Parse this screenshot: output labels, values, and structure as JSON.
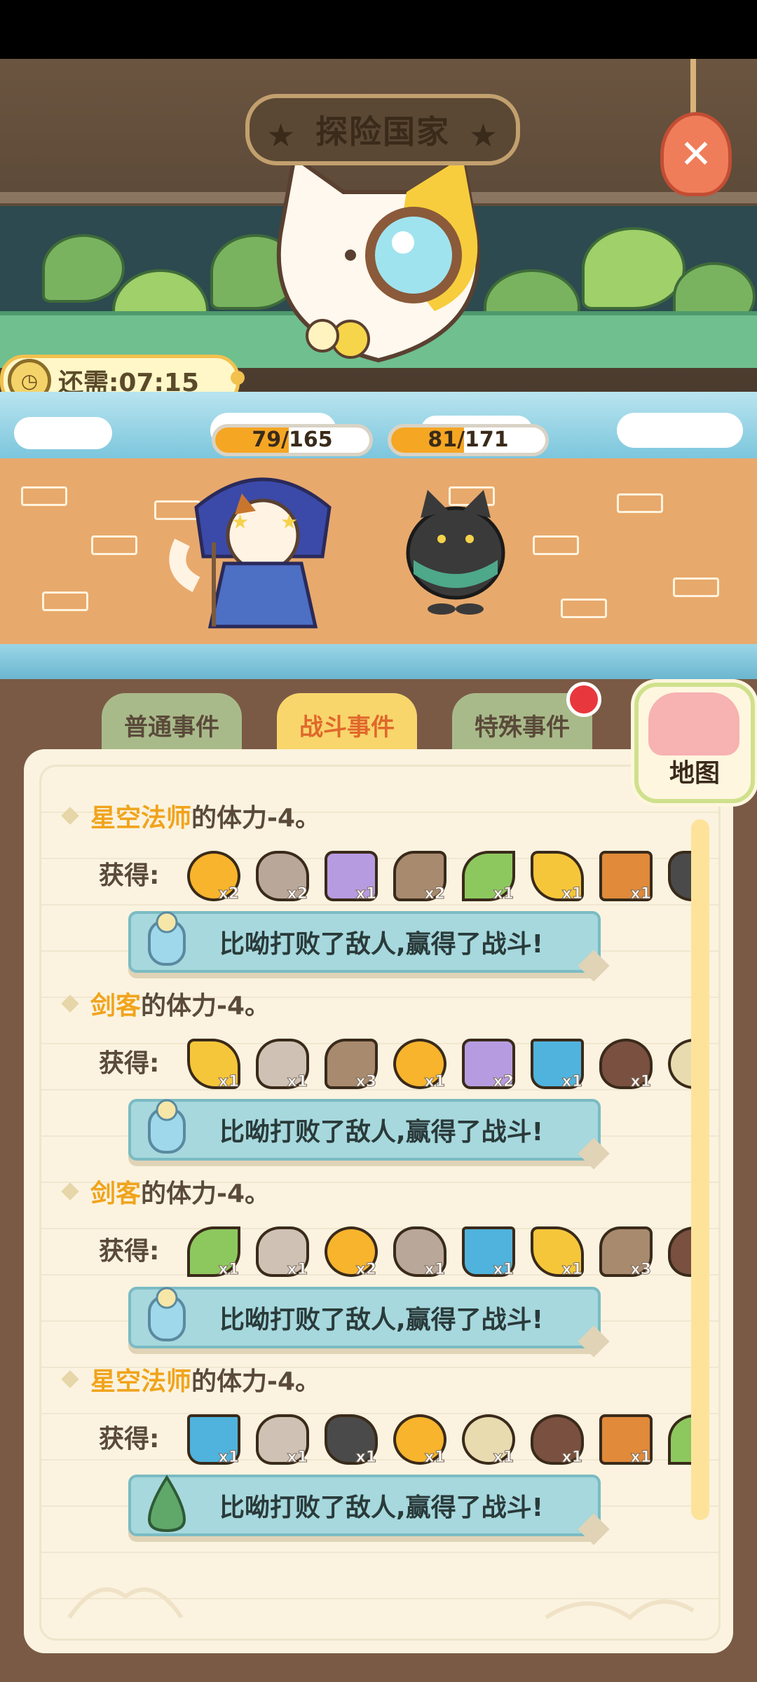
{
  "window": {
    "title": "探险国家"
  },
  "timer": {
    "label": "还需:07:15"
  },
  "battle": {
    "hero_hp": {
      "text": "79/165",
      "current": 79,
      "max": 165
    },
    "enemy_hp": {
      "text": "81/171",
      "current": 81,
      "max": 171
    }
  },
  "tabs": [
    {
      "label": "普通事件"
    },
    {
      "label": "战斗事件",
      "active": true
    },
    {
      "label": "特殊事件",
      "badge": "red-dot"
    }
  ],
  "map_button": {
    "label": "地图"
  },
  "obtain_label": "获得:",
  "entries": [
    {
      "name": "星空法师",
      "rest": "的体力-4。",
      "items": [
        {
          "icon": "yarn-ball-icon",
          "qty": "x2"
        },
        {
          "icon": "rocks-icon",
          "qty": "x2"
        },
        {
          "icon": "purple-spool-icon",
          "qty": "x1"
        },
        {
          "icon": "logs-icon",
          "qty": "x2"
        },
        {
          "icon": "green-leaf-icon",
          "qty": "x1"
        },
        {
          "icon": "coral-branch-icon",
          "qty": "x1"
        },
        {
          "icon": "wood-planks-icon",
          "qty": "x1"
        },
        {
          "icon": "coal-icon",
          "qty": ""
        }
      ],
      "message": "比呦打败了敌人,赢得了战斗!",
      "message_icon": "cloud-jar-icon"
    },
    {
      "name": "剑客",
      "rest": "的体力-4。",
      "items": [
        {
          "icon": "coral-branch-icon",
          "qty": "x1"
        },
        {
          "icon": "stone-icon",
          "qty": "x1"
        },
        {
          "icon": "logs-icon",
          "qty": "x3"
        },
        {
          "icon": "yarn-ball-icon",
          "qty": "x1"
        },
        {
          "icon": "purple-spool-icon",
          "qty": "x2"
        },
        {
          "icon": "paint-bucket-icon",
          "qty": "x1"
        },
        {
          "icon": "brown-bean-icon",
          "qty": "x1"
        },
        {
          "icon": "rope-coil-icon",
          "qty": ""
        }
      ],
      "message": "比呦打败了敌人,赢得了战斗!",
      "message_icon": "cloud-jar-icon"
    },
    {
      "name": "剑客",
      "rest": "的体力-4。",
      "items": [
        {
          "icon": "green-leaf-icon",
          "qty": "x1"
        },
        {
          "icon": "stone-icon",
          "qty": "x1"
        },
        {
          "icon": "yarn-ball-icon",
          "qty": "x2"
        },
        {
          "icon": "rocks-icon",
          "qty": "x1"
        },
        {
          "icon": "paint-bucket-icon",
          "qty": "x1"
        },
        {
          "icon": "coral-branch-icon",
          "qty": "x1"
        },
        {
          "icon": "logs-icon",
          "qty": "x3"
        },
        {
          "icon": "brown-bean-icon",
          "qty": ""
        }
      ],
      "message": "比呦打败了敌人,赢得了战斗!",
      "message_icon": "cloud-jar-icon"
    },
    {
      "name": "星空法师",
      "rest": "的体力-4。",
      "items": [
        {
          "icon": "paint-bucket-icon",
          "qty": "x1"
        },
        {
          "icon": "stone-icon",
          "qty": "x1"
        },
        {
          "icon": "coal-icon",
          "qty": "x1"
        },
        {
          "icon": "yarn-ball-icon",
          "qty": "x1"
        },
        {
          "icon": "rope-coil-icon",
          "qty": "x1"
        },
        {
          "icon": "brown-bean-icon",
          "qty": "x1"
        },
        {
          "icon": "wood-planks-icon",
          "qty": "x1"
        },
        {
          "icon": "green-leaf-icon",
          "qty": ""
        }
      ],
      "message": "比呦打败了敌人,赢得了战斗!",
      "message_icon": "green-slime-icon"
    }
  ],
  "colors": {
    "name_highlight": "#f0a41c",
    "active_tab": "#f8d66c",
    "inactive_tab": "#a9ba8a",
    "hp_fill": "#f5a623",
    "banner": "#a6d8dd"
  }
}
